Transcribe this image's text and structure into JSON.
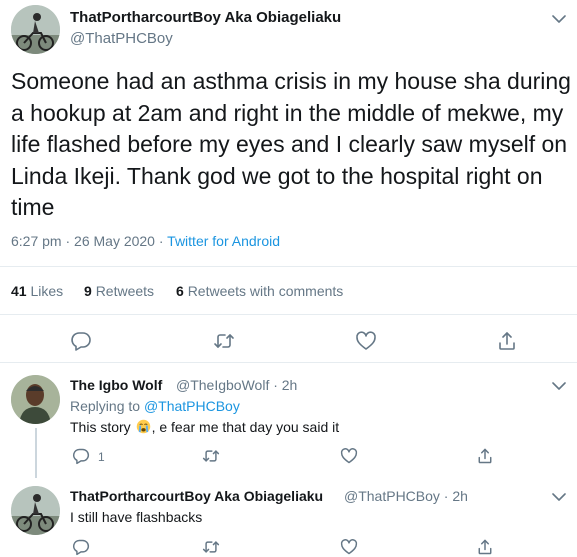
{
  "main_tweet": {
    "author_name": "ThatPortharcourtBoy Aka Obiageliaku",
    "author_handle": "@ThatPHCBoy",
    "text": "Someone had an asthma crisis in my house sha during a hookup at 2am and right in the middle of mekwe, my life flashed before my eyes and I clearly saw myself on Linda Ikeji. Thank god we got to the hospital right on time",
    "time": "6:27 pm · 26 May 2020 · ",
    "source": "Twitter for Android",
    "likes_count": "41",
    "likes_label": "Likes",
    "retweets_count": "9",
    "retweets_label": "Retweets",
    "quote_count": "6",
    "quote_label": "Retweets with comments"
  },
  "replies": [
    {
      "author_name": "The Igbo Wolf",
      "author_handle": "@TheIgboWolf · 2h",
      "replying_prefix": "Replying to ",
      "replying_mention": "@ThatPHCBoy",
      "text_before_emoji": "This story ",
      "emoji": "crying-face",
      "text_after_emoji": ", e fear me that day you said it",
      "reply_count": "1"
    },
    {
      "author_name": "ThatPortharcourtBoy Aka Obiageliaku",
      "author_handle": "@ThatPHCBoy · 2h",
      "text": "I still have flashbacks"
    }
  ],
  "icons": [
    "chevron-down-icon",
    "reply-icon",
    "retweet-icon",
    "like-icon",
    "share-icon"
  ],
  "colors": {
    "link": "#1b95e0",
    "secondary_text": "#657786",
    "primary_text": "#14171a",
    "divider": "#e6ecf0"
  }
}
